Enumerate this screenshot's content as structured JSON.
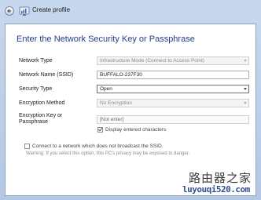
{
  "window": {
    "title": "Create profile"
  },
  "heading": "Enter the Network Security Key or Passphrase",
  "form": {
    "network_type": {
      "label": "Network Type",
      "value": "Infrastructure Mode (Connect to Access Point)"
    },
    "network_name": {
      "label": "Network Name (SSID)",
      "value": "BUFFALO-237F30"
    },
    "security_type": {
      "label": "Security Type",
      "value": "Open"
    },
    "encryption_method": {
      "label": "Encryption Method",
      "value": "No Encryption"
    },
    "encryption_key": {
      "label_line1": "Encryption Key or",
      "label_line2": "Passphrase",
      "value": "[Not enter]"
    },
    "display_chars": {
      "label": "Display entered characters",
      "checked": true
    },
    "hidden_ssid": {
      "label": "Connect to a network which does not broadcast the SSID.",
      "checked": false
    },
    "warning": "Warning: If you select this option, this PC's privacy may be exposed to danger."
  },
  "watermark": {
    "chinese": "路由器之家",
    "url": "luyouqi520.com"
  },
  "icons": {
    "back": "back-arrow-icon",
    "title": "wireless-network-icon"
  }
}
